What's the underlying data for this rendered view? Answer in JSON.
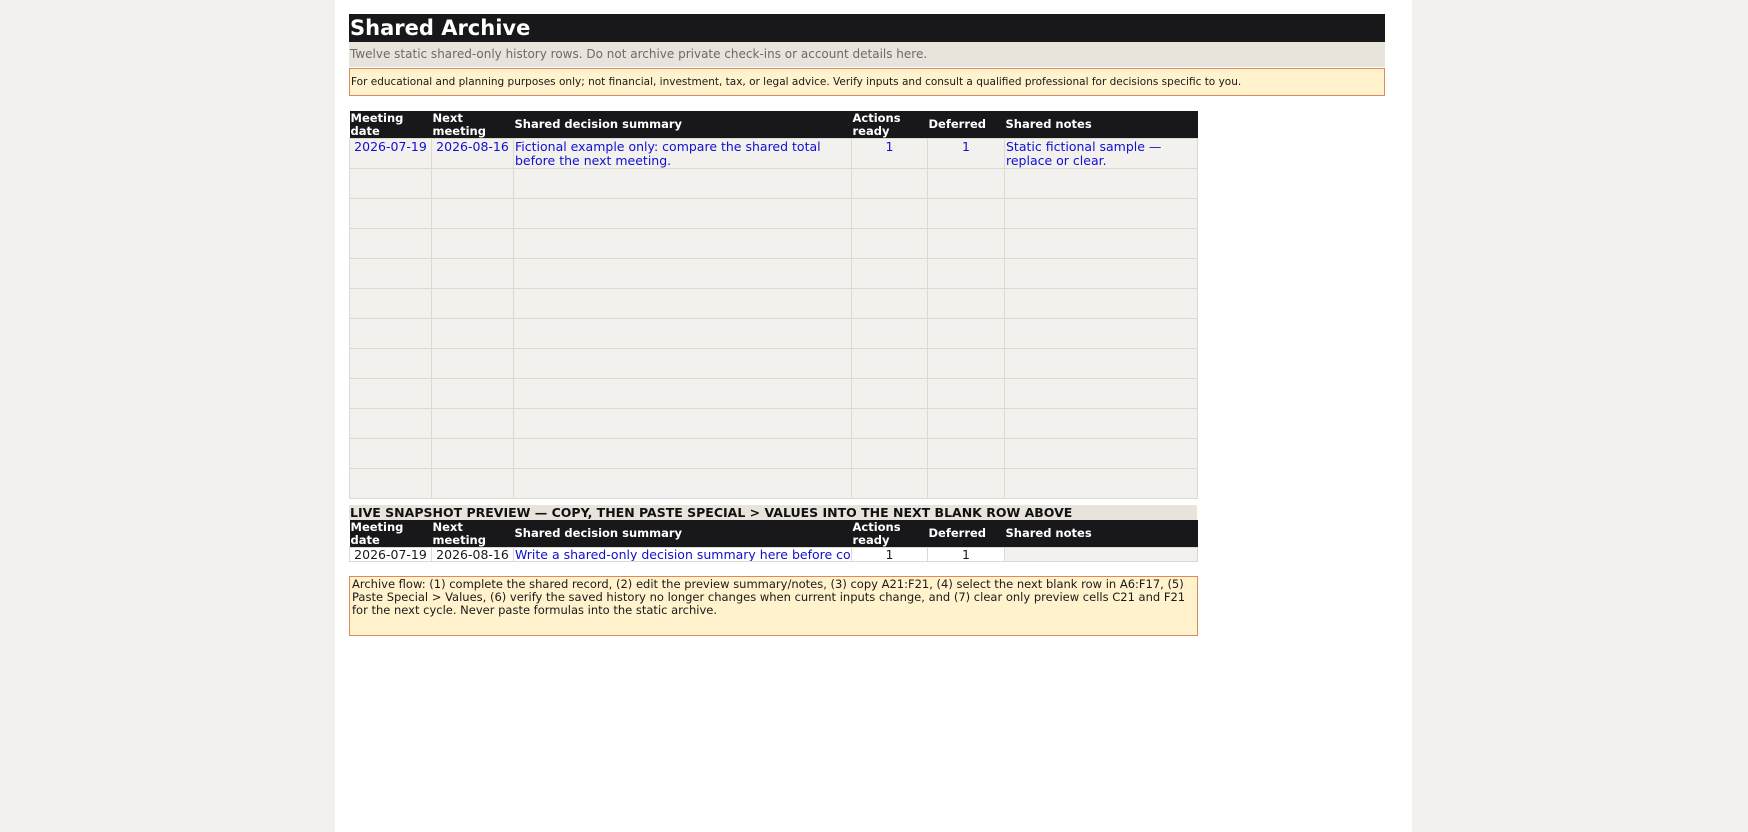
{
  "sheet": {
    "title": "Shared Archive",
    "subtitle": "Twelve static shared-only history rows. Do not archive private check-ins or account details here.",
    "disclaimer": "For educational and planning purposes only; not financial, investment, tax, or legal advice. Verify inputs and consult a qualified professional for decisions specific to you."
  },
  "archive": {
    "headers": [
      "Meeting date",
      "Next meeting",
      "Shared decision summary",
      "Actions ready",
      "Deferred",
      "Shared notes"
    ],
    "rows": [
      [
        "2026-07-19",
        "2026-08-16",
        "Fictional example only: compare the shared total before the next meeting.",
        "1",
        "1",
        "Static fictional sample — replace or clear."
      ],
      [
        "",
        "",
        "",
        "",
        "",
        ""
      ],
      [
        "",
        "",
        "",
        "",
        "",
        ""
      ],
      [
        "",
        "",
        "",
        "",
        "",
        ""
      ],
      [
        "",
        "",
        "",
        "",
        "",
        ""
      ],
      [
        "",
        "",
        "",
        "",
        "",
        ""
      ],
      [
        "",
        "",
        "",
        "",
        "",
        ""
      ],
      [
        "",
        "",
        "",
        "",
        "",
        ""
      ],
      [
        "",
        "",
        "",
        "",
        "",
        ""
      ],
      [
        "",
        "",
        "",
        "",
        "",
        ""
      ],
      [
        "",
        "",
        "",
        "",
        "",
        ""
      ],
      [
        "",
        "",
        "",
        "",
        "",
        ""
      ]
    ]
  },
  "preview": {
    "label": "LIVE SNAPSHOT PREVIEW — COPY, THEN PASTE SPECIAL > VALUES INTO THE NEXT BLANK ROW ABOVE",
    "headers": [
      "Meeting date",
      "Next meeting",
      "Shared decision summary",
      "Actions ready",
      "Deferred",
      "Shared notes"
    ],
    "row": [
      "2026-07-19",
      "2026-08-16",
      "Write a shared-only decision summary here before copying.",
      "1",
      "1",
      ""
    ]
  },
  "flow_note": "Archive flow: (1) complete the shared record, (2) edit the preview summary/notes, (3) copy A21:F21, (4) select the next blank row in A6:F17, (5) Paste Special > Values, (6) verify the saved history no longer changes when current inputs change, and (7) clear only preview cells C21 and F21 for the next cycle. Never paste formulas into the static archive.",
  "colors": {
    "header_bg": "#18181b",
    "input_text": "#1010d0",
    "note_bg": "#fff2cc",
    "note_border": "#d98b5f",
    "band_bg": "#e8e4dc",
    "archive_cell_bg": "#f3f1ee"
  }
}
